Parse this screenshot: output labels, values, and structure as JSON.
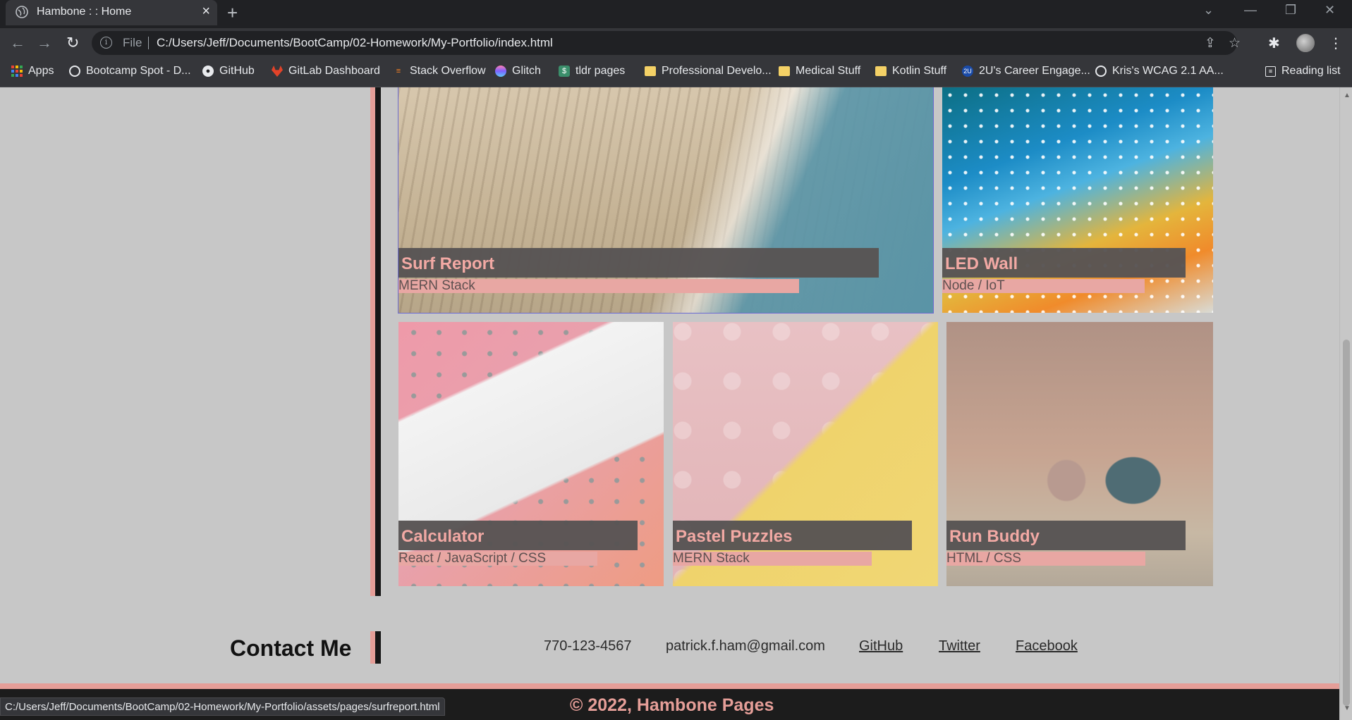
{
  "browser": {
    "tab_title": "Hambone : : Home",
    "file_label": "File",
    "url": "C:/Users/Jeff/Documents/BootCamp/02-Homework/My-Portfolio/index.html",
    "reading_list": "Reading list",
    "status_url": "C:/Users/Jeff/Documents/BootCamp/02-Homework/My-Portfolio/assets/pages/surfreport.html"
  },
  "bookmarks": [
    {
      "label": "Apps",
      "icon": "apps-grid-icon"
    },
    {
      "label": "Bootcamp Spot - D...",
      "icon": "globe-icon"
    },
    {
      "label": "GitHub",
      "icon": "github-icon"
    },
    {
      "label": "GitLab Dashboard",
      "icon": "gitlab-icon"
    },
    {
      "label": "Stack Overflow",
      "icon": "stackoverflow-icon"
    },
    {
      "label": "Glitch",
      "icon": "glitch-icon"
    },
    {
      "label": "tldr pages",
      "icon": "tldr-icon"
    },
    {
      "label": "Professional Develo...",
      "icon": "folder-icon"
    },
    {
      "label": "Medical Stuff",
      "icon": "folder-icon"
    },
    {
      "label": "Kotlin Stuff",
      "icon": "folder-icon"
    },
    {
      "label": "2U's Career Engage...",
      "icon": "2u-icon"
    },
    {
      "label": "Kris's WCAG 2.1 AA...",
      "icon": "globe-icon"
    }
  ],
  "projects": [
    {
      "title": "Surf Report",
      "stack": "MERN Stack"
    },
    {
      "title": "LED Wall",
      "stack": "Node / IoT"
    },
    {
      "title": "Calculator",
      "stack": "React / JavaScript / CSS"
    },
    {
      "title": "Pastel Puzzles",
      "stack": "MERN Stack"
    },
    {
      "title": "Run Buddy",
      "stack": "HTML / CSS"
    }
  ],
  "contact": {
    "heading": "Contact Me",
    "phone": "770-123-4567",
    "email": "patrick.f.ham@gmail.com",
    "github": "GitHub",
    "twitter": "Twitter",
    "facebook": "Facebook"
  },
  "footer": {
    "text": "© 2022, Hambone Pages"
  },
  "colors": {
    "accent_salmon": "#e59e98",
    "page_background": "#c7c7c7",
    "card_title_background": "#585454",
    "footer_background": "#1c1c1c"
  }
}
